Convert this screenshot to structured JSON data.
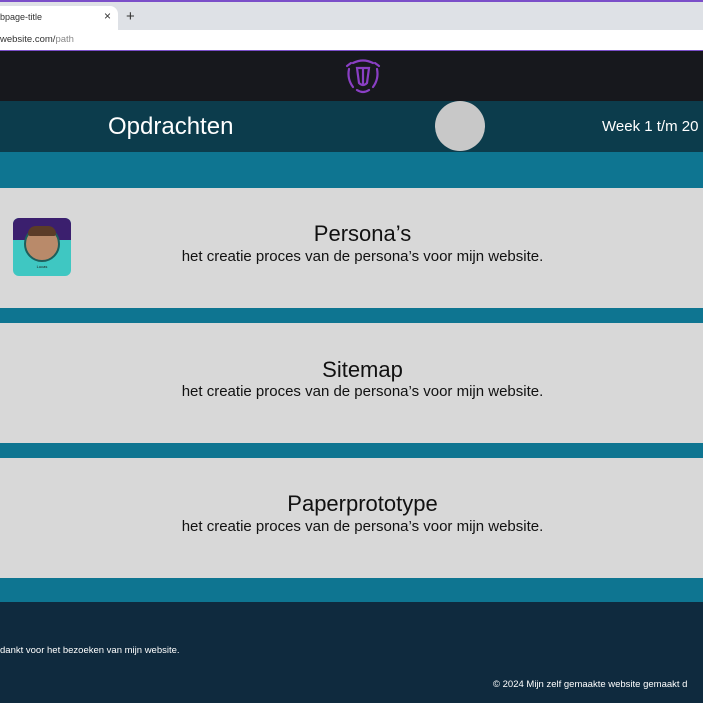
{
  "browser": {
    "tab_title": "bpage-title",
    "tab_close": "×",
    "new_tab": "+",
    "url_host": "website.com/",
    "url_path": "path"
  },
  "header": {
    "title": "Opdrachten",
    "week_label": "Week 1 t/m 20"
  },
  "cards": [
    {
      "title": "Persona’s",
      "description": "het creatie proces van de persona’s voor mijn website.",
      "thumbnail_caption": "Lucas"
    },
    {
      "title": "Sitemap",
      "description": "het creatie proces van de persona’s voor mijn website."
    },
    {
      "title": "Paperprototype",
      "description": "het creatie proces van de persona’s voor mijn website."
    }
  ],
  "footer": {
    "thanks": "dankt voor het bezoeken van mijn website.",
    "copyright": "© 2024 Mijn zelf gemaakte website  gemaakt d"
  },
  "colors": {
    "logo_purple": "#8a3fc4",
    "header_bg": "#0c3c4c",
    "content_bg": "#0e7591",
    "card_bg": "#d8d8d8",
    "footer_bg": "#0f2a3e"
  }
}
